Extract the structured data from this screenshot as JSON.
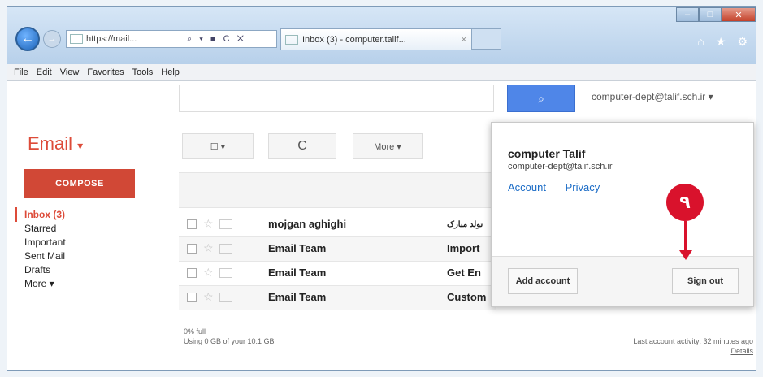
{
  "browser": {
    "address_url": "https://mail...",
    "address_controls": "⌕ ▾ ■ C ✕",
    "tab_title": "Inbox (3) - computer.talif...",
    "tab_close": "×",
    "menu": [
      "File",
      "Edit",
      "View",
      "Favorites",
      "Tools",
      "Help"
    ],
    "right_icons": [
      "home-icon",
      "star-icon",
      "gear-icon"
    ]
  },
  "header": {
    "search_button_icon": "⌕",
    "account_email": "computer-dept@talif.sch.ir"
  },
  "sidebar": {
    "brand": "Email",
    "brand_caret": "▾",
    "compose_label": "COMPOSE",
    "items": [
      {
        "label": "Inbox (3)"
      },
      {
        "label": "Starred"
      },
      {
        "label": "Important"
      },
      {
        "label": "Sent Mail"
      },
      {
        "label": "Drafts"
      },
      {
        "label": "More ▾"
      }
    ]
  },
  "toolbar": {
    "select_label": "☐ ▾",
    "refresh_label": "C",
    "more_label": "More ▾"
  },
  "messages": [
    {
      "sender": "mojgan aghighi",
      "subject": "تولد مبارک"
    },
    {
      "sender": "Email Team",
      "subject": "Import"
    },
    {
      "sender": "Email Team",
      "subject": "Get En"
    },
    {
      "sender": "Email Team",
      "subject": "Custom"
    }
  ],
  "footer": {
    "usage_pct": "0% full",
    "usage": "Using 0 GB of your 10.1 GB",
    "last_activity": "Last account activity: 32 minutes ago",
    "details": "Details"
  },
  "account_popup": {
    "name": "computer Talif",
    "email": "computer-dept@talif.sch.ir",
    "account_link": "Account",
    "privacy_link": "Privacy",
    "add_account": "Add account",
    "sign_out": "Sign out"
  },
  "annotation": {
    "step_number": "٩",
    "color": "#d9122c"
  },
  "colors": {
    "brand_red": "#dd4b39",
    "compose_red": "#d14836",
    "search_blue": "#4f86e8",
    "link_blue": "#1a6bc6"
  }
}
